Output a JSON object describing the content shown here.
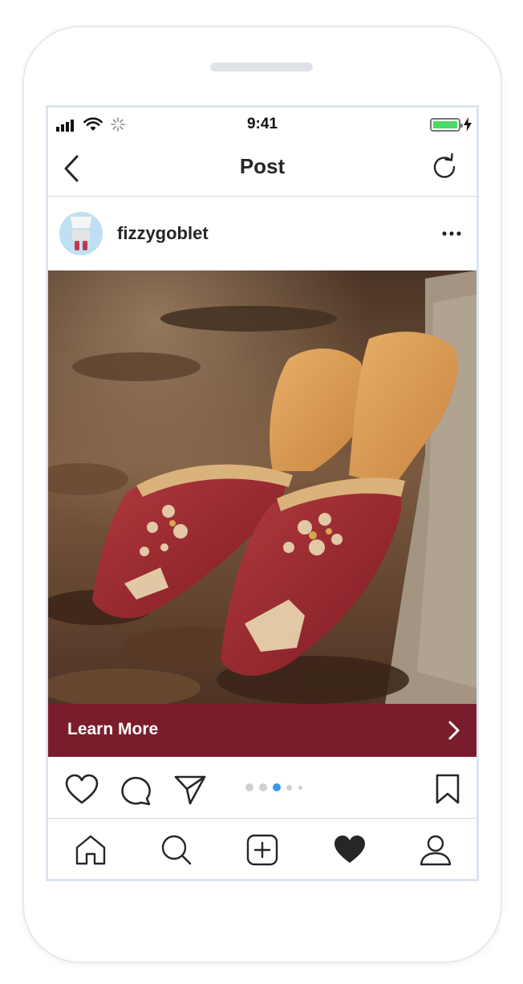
{
  "status_bar": {
    "time": "9:41"
  },
  "nav": {
    "title": "Post"
  },
  "post": {
    "username": "fizzygoblet",
    "cta_label": "Learn More",
    "image_subject": "red embroidered mule slippers on autumn leaves"
  },
  "carousel": {
    "count": 5,
    "active_index": 2
  },
  "tabbar": {
    "items": [
      "home-icon",
      "search-icon",
      "new-post-icon",
      "activity-heart-icon",
      "profile-icon"
    ],
    "active": "activity-heart-icon"
  },
  "colors": {
    "cta_background": "#7b1c2c",
    "carousel_active_dot": "#3897f0",
    "battery_fill": "#4cd964"
  }
}
